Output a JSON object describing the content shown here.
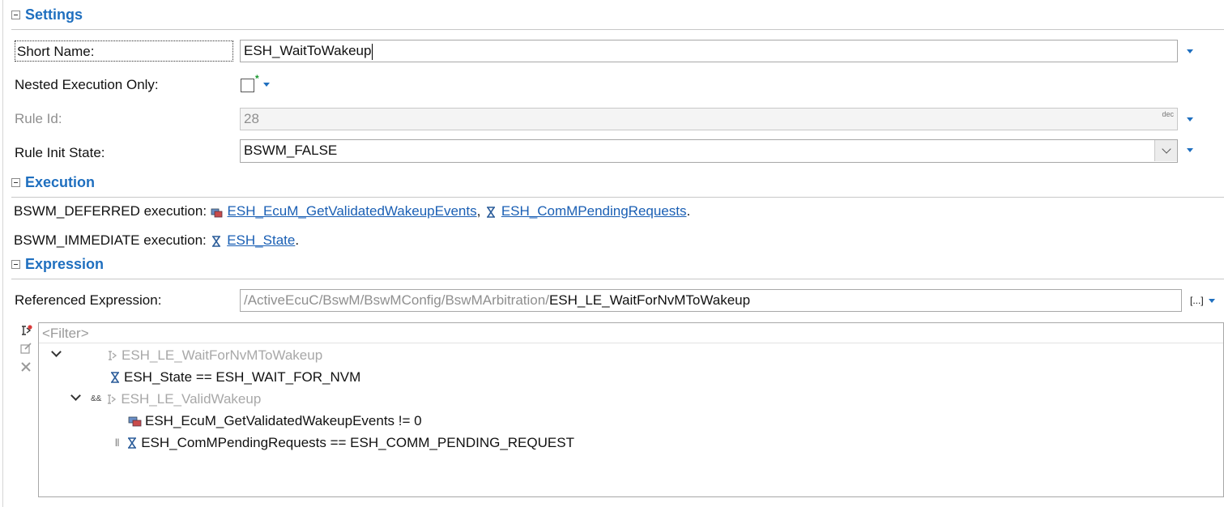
{
  "sections": {
    "settings": "Settings",
    "execution": "Execution",
    "expression": "Expression"
  },
  "settings": {
    "short_name_label": "Short Name:",
    "short_name_value": "ESH_WaitToWakeup",
    "nested_label": "Nested Execution Only:",
    "nested_checked": false,
    "nested_marker": "*",
    "rule_id_label": "Rule Id:",
    "rule_id_value": "28",
    "rule_id_format": "dec",
    "init_state_label": "Rule Init State:",
    "init_state_value": "BSWM_FALSE"
  },
  "execution": {
    "deferred_label": "BSWM_DEFERRED execution:",
    "deferred_links": [
      "ESH_EcuM_GetValidatedWakeupEvents",
      "ESH_ComMPendingRequests"
    ],
    "separator": ",",
    "terminator": ".",
    "immediate_label": "BSWM_IMMEDIATE execution:",
    "immediate_links": [
      "ESH_State"
    ]
  },
  "expression": {
    "ref_label": "Referenced Expression:",
    "ref_path_prefix": "/ActiveEcuC/BswM/BswMConfig/BswMArbitration/",
    "ref_path_name": "ESH_LE_WaitForNvMToWakeup",
    "browse_label": "[...]",
    "filter_placeholder": "<Filter>",
    "tree": {
      "root": "ESH_LE_WaitForNvMToWakeup",
      "cond1": "ESH_State == ESH_WAIT_FOR_NVM",
      "and_op": "&&",
      "sub": "ESH_LE_ValidWakeup",
      "cond2": "ESH_EcuM_GetValidatedWakeupEvents != 0",
      "or_op": "||",
      "cond3": "ESH_ComMPendingRequests == ESH_COMM_PENDING_REQUEST"
    }
  },
  "colors": {
    "section_title": "#1f6fbf",
    "link": "#1a5fb4",
    "star": "#1c9b32",
    "disabled_text": "#8f8f8f"
  },
  "icons": {
    "mode_request": "hourglass-icon",
    "event": "event-icon",
    "logical": "logical-expression-icon"
  }
}
